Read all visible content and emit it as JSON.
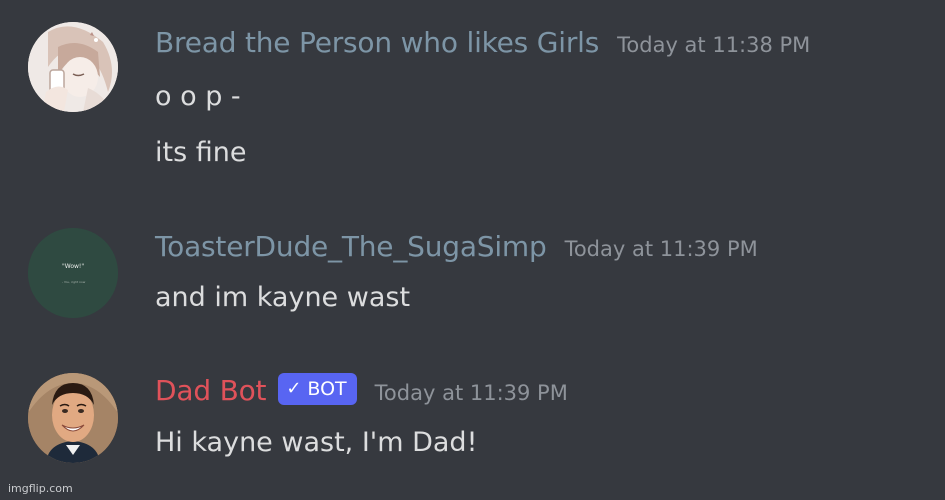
{
  "messages": [
    {
      "username": "Bread the Person who likes Girls",
      "timestamp": "Today at 11:38 PM",
      "is_bot": false,
      "lines": [
        "o o p -",
        "its fine"
      ],
      "avatar": "anime-character-avatar"
    },
    {
      "username": "ToasterDude_The_SugaSimp",
      "timestamp": "Today at 11:39 PM",
      "is_bot": false,
      "lines": [
        "and im kayne wast"
      ],
      "avatar_text": "\"Wow!\"",
      "avatar_subtext": "- You, right now"
    },
    {
      "username": "Dad Bot",
      "timestamp": "Today at 11:39 PM",
      "is_bot": true,
      "bot_tag": "BOT",
      "lines": [
        "Hi kayne wast, I'm Dad!"
      ],
      "avatar": "smiling-man-avatar"
    }
  ],
  "watermark": "imgflip.com",
  "colors": {
    "background": "#36393f",
    "username": "#7d95a6",
    "bot_username": "#e0525a",
    "timestamp": "#8e939a",
    "message_text": "#dcddde",
    "bot_tag": "#5865f2"
  }
}
